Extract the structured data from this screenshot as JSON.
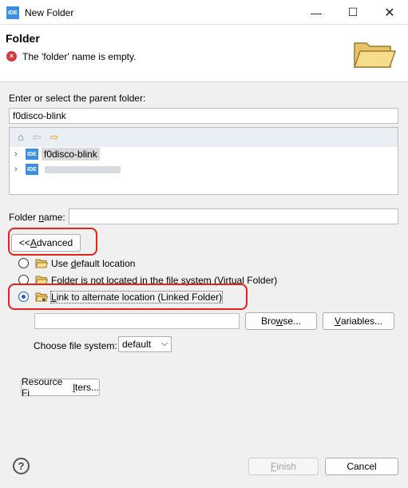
{
  "window": {
    "app_icon_text": "IDE",
    "title": "New Folder",
    "min_glyph": "—",
    "max_glyph": "☐",
    "close_glyph": "✕"
  },
  "header": {
    "title": "Folder",
    "error_message": "The 'folder' name is empty.",
    "error_icon_glyph": "×"
  },
  "parent": {
    "label": "Enter or select the parent folder:",
    "value": "f0disco-blink"
  },
  "tree": {
    "toolbar_icons": [
      "home-icon",
      "back-arrow-icon",
      "forward-arrow-icon"
    ],
    "items": [
      {
        "icon_text": "IDE",
        "label": "f0disco-blink",
        "selected": true
      },
      {
        "icon_text": "IDE",
        "label": "",
        "redacted": true
      }
    ]
  },
  "folder_name": {
    "label_pre": "Folder ",
    "label_u": "n",
    "label_post": "ame:",
    "value": ""
  },
  "advanced_button": {
    "pre": "<< ",
    "u": "A",
    "post": "dvanced"
  },
  "location_options": [
    {
      "pre": "Use ",
      "u": "d",
      "post": "efault location",
      "checked": false
    },
    {
      "pre": "",
      "u": "F",
      "post": "older is not located in the file system (Virtual Folder)",
      "checked": false
    },
    {
      "pre": "",
      "u": "L",
      "post": "ink to alternate location (Linked Folder)",
      "checked": true
    }
  ],
  "link": {
    "path_value": "",
    "browse": {
      "pre": "Bro",
      "u": "w",
      "post": "se..."
    },
    "variables": {
      "pre": "",
      "u": "V",
      "post": "ariables..."
    }
  },
  "file_system": {
    "label": "Choose file system:",
    "selected": "default"
  },
  "resource_filters": {
    "pre": "Resource Fi",
    "u": "l",
    "post": "ters..."
  },
  "footer": {
    "help_glyph": "?",
    "finish": {
      "pre": "",
      "u": "F",
      "post": "inish",
      "enabled": false
    },
    "cancel": "Cancel"
  },
  "colors": {
    "accent": "#1f5fbf",
    "error": "#d23c3c",
    "highlight_box": "#e3241b",
    "ide_icon": "#3d8ee0"
  }
}
